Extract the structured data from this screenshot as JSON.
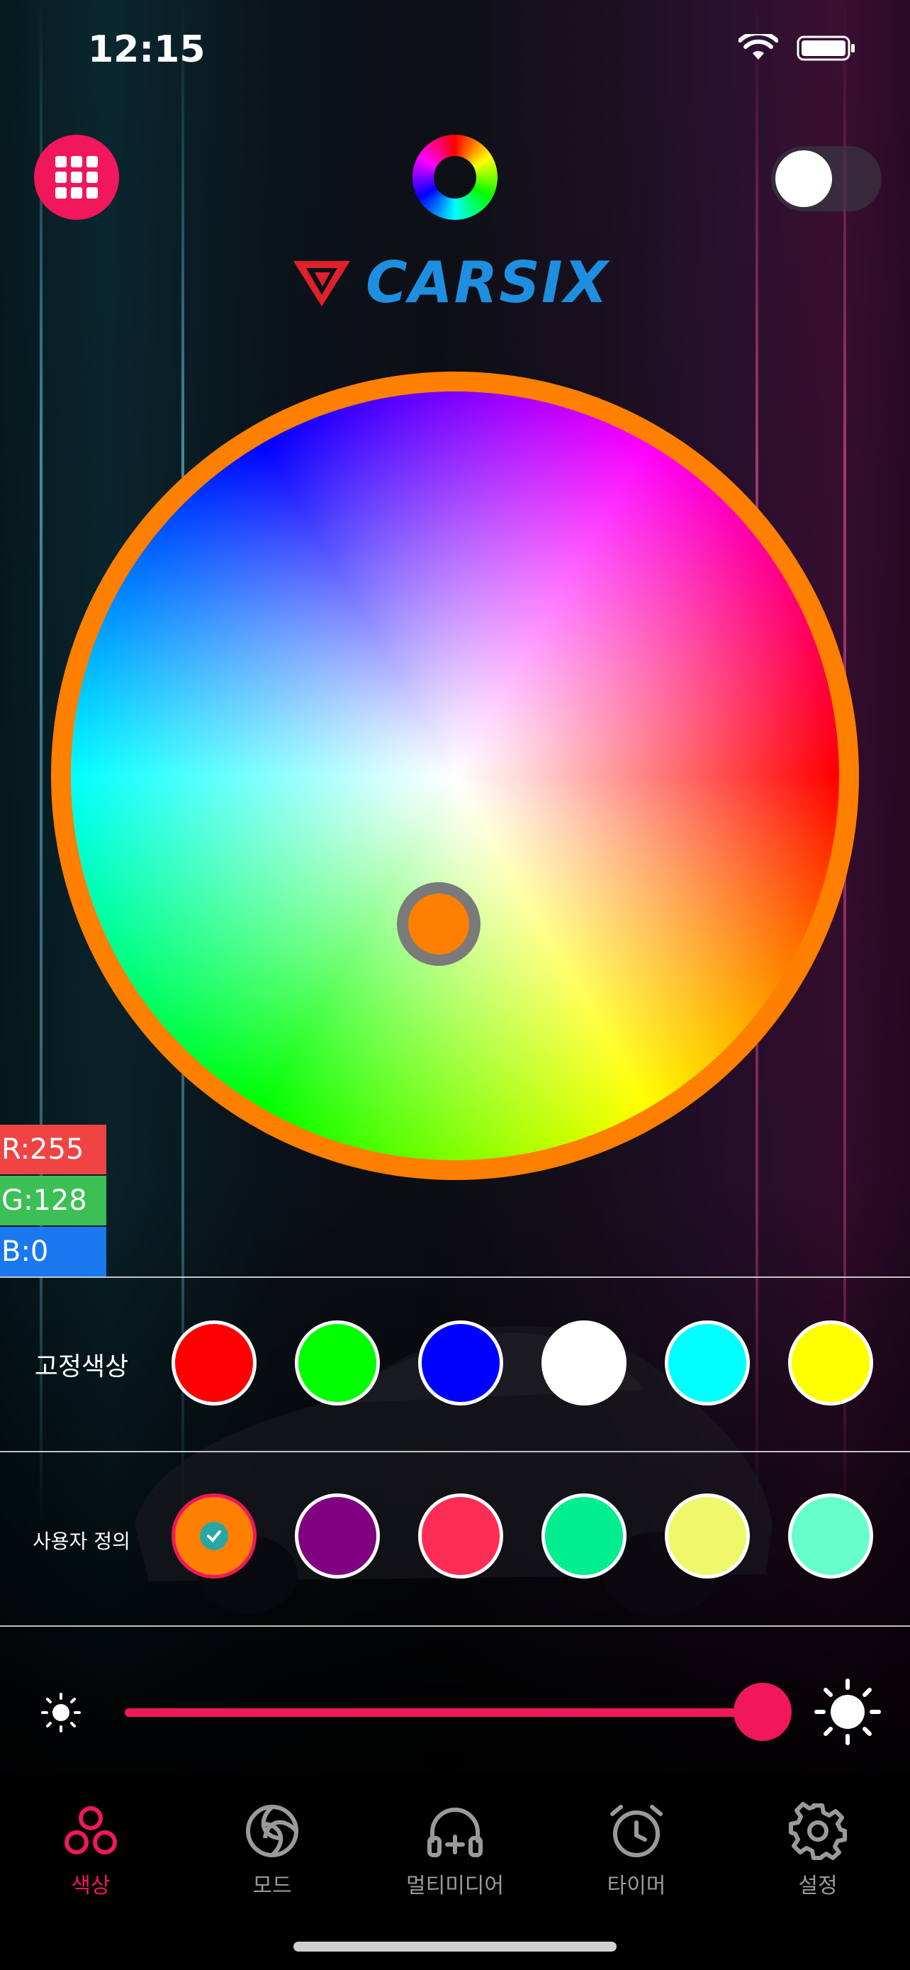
{
  "status_bar": {
    "time": "12:15"
  },
  "logo": {
    "text": "CARSIX"
  },
  "rgb": {
    "r": "R:255",
    "g": "G:128",
    "b": "B:0"
  },
  "rows": {
    "fixed": {
      "label": "고정색상",
      "colors": [
        "#ff0000",
        "#00ff00",
        "#0000ff",
        "#ffffff",
        "#00ffff",
        "#ffff00"
      ]
    },
    "custom": {
      "label": "사용자 정의",
      "colors": [
        "#ff7f00",
        "#800080",
        "#ff2d55",
        "#00ee90",
        "#eef86a",
        "#66ffcc"
      ],
      "selected_index": 0
    }
  },
  "brightness": {
    "level_percent": 100
  },
  "colors": {
    "accent": "#f0185a",
    "selected_color": "#ff7f00"
  },
  "tabs": [
    {
      "label": "색상",
      "icon": "color-circles-icon",
      "active": true
    },
    {
      "label": "모드",
      "icon": "mode-swirl-icon",
      "active": false
    },
    {
      "label": "멀티미디어",
      "icon": "multimedia-headphones-icon",
      "active": false
    },
    {
      "label": "타이머",
      "icon": "timer-alarm-icon",
      "active": false
    },
    {
      "label": "설정",
      "icon": "settings-gear-icon",
      "active": false
    }
  ]
}
